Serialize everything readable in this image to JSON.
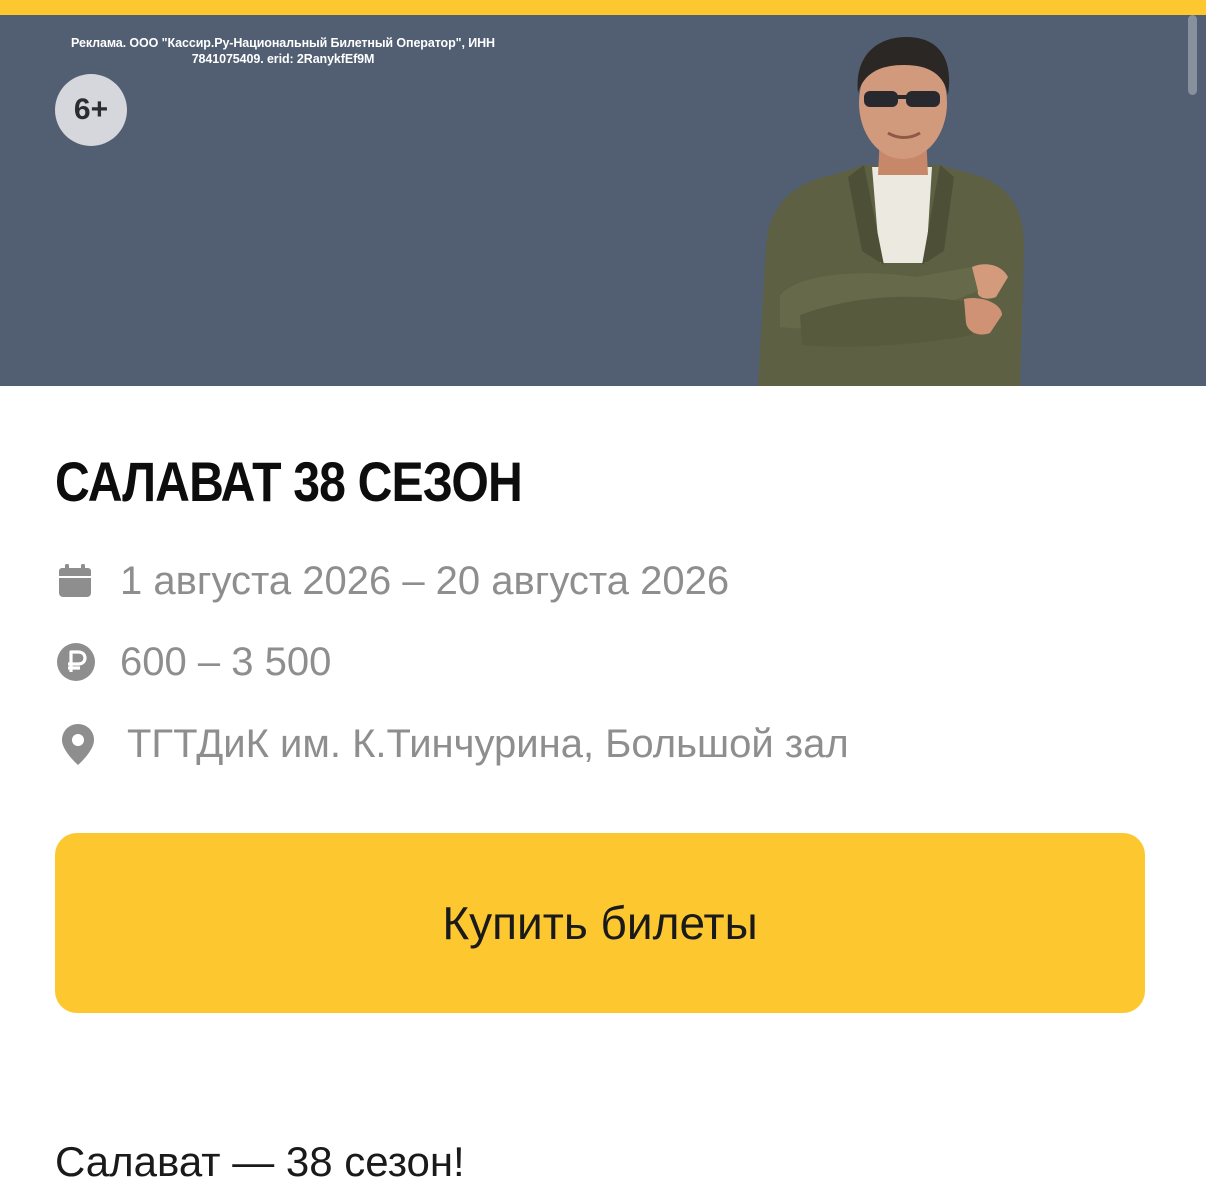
{
  "banner": {
    "ad_line1": "Реклама. ООО \"Кассир.Ру-Национальный Билетный Оператор\", ИНН",
    "ad_line2": "7841075409. erid: 2RanykfEf9M",
    "age_rating": "6+"
  },
  "event": {
    "title": "САЛАВАТ 38 СЕЗОН",
    "dates": "1 августа 2026 – 20 августа 2026",
    "price": "600 – 3 500",
    "venue": "ТГТДиК им. К.Тинчурина, Большой зал",
    "description": "Салават — 38 сезон!"
  },
  "actions": {
    "buy_label": "Купить билеты"
  },
  "icons": {
    "dates": "calendar-icon",
    "price": "ruble-icon",
    "venue": "location-pin-icon"
  },
  "colors": {
    "accent": "#fdc82f",
    "banner_bg": "#525f72",
    "muted_text": "#8e8e8e"
  }
}
